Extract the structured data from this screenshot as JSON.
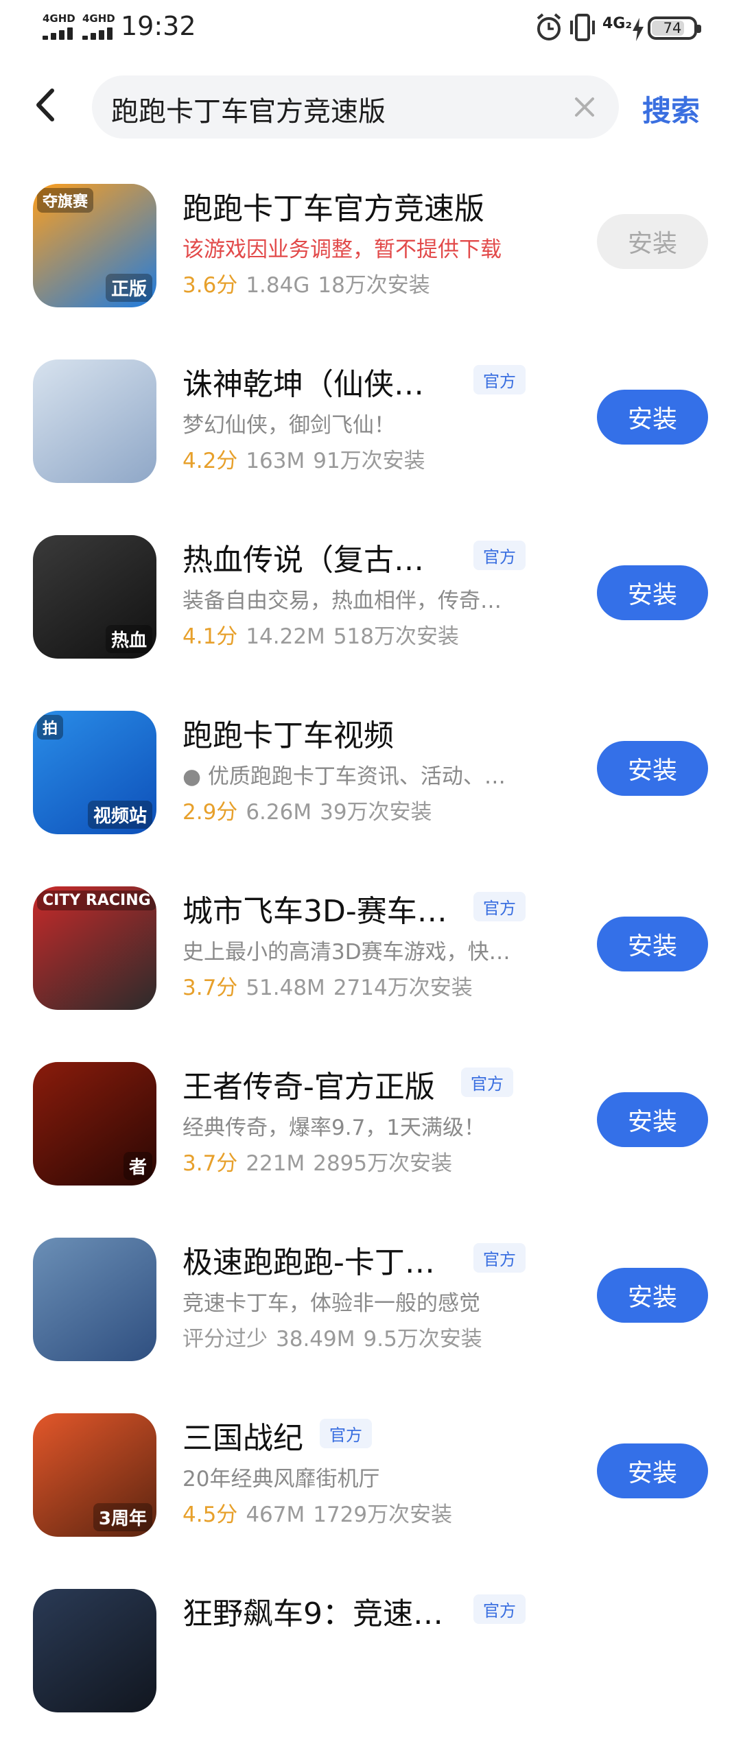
{
  "status_bar": {
    "network_1": "4GHD",
    "network_2": "4GHD",
    "time": "19:32",
    "network_3": "4G₂",
    "battery": "74"
  },
  "search": {
    "query": "跑跑卡丁车官方竞速版",
    "button_label": "搜索"
  },
  "apps": [
    {
      "name": "跑跑卡丁车官方竞速版",
      "official": "",
      "desc": "该游戏因业务调整，暂不提供下载",
      "rating": "3.6分",
      "size": "1.84G",
      "installs": "18万次安装",
      "button": "安装",
      "colors": [
        "#ff9f1c",
        "#1e7be0"
      ],
      "badge_text": "夺旗赛",
      "corner_text": "正版"
    },
    {
      "name": "诛神乾坤（仙侠…",
      "official": "官方",
      "desc": "梦幻仙侠，御剑飞仙！",
      "rating": "4.2分",
      "size": "163M",
      "installs": "91万次安装",
      "button": "安装",
      "colors": [
        "#d7e2ee",
        "#8fa7c7"
      ],
      "badge_text": "",
      "corner_text": ""
    },
    {
      "name": "热血传说（复古…",
      "official": "官方",
      "desc": "装备自由交易，热血相伴，传奇…",
      "rating": "4.1分",
      "size": "14.22M",
      "installs": "518万次安装",
      "button": "安装",
      "colors": [
        "#3a3a3a",
        "#111111"
      ],
      "badge_text": "",
      "corner_text": "热血"
    },
    {
      "name": "跑跑卡丁车视频",
      "official": "",
      "desc": "● 优质跑跑卡丁车资讯、活动、…",
      "rating": "2.9分",
      "size": "6.26M",
      "installs": "39万次安装",
      "button": "安装",
      "colors": [
        "#2a8de8",
        "#0d4fb8"
      ],
      "badge_text": "拍",
      "corner_text": "视频站"
    },
    {
      "name": "城市飞车3D-赛车…",
      "official": "官方",
      "desc": "史上最小的高清3D赛车游戏，快…",
      "rating": "3.7分",
      "size": "51.48M",
      "installs": "2714万次安装",
      "button": "安装",
      "colors": [
        "#c92a2a",
        "#2b2b2b"
      ],
      "badge_text": "CITY RACING",
      "corner_text": ""
    },
    {
      "name": "王者传奇-官方正版",
      "official": "官方",
      "desc": "经典传奇，爆率9.7，1天满级！",
      "rating": "3.7分",
      "size": "221M",
      "installs": "2895万次安装",
      "button": "安装",
      "colors": [
        "#8a1c0c",
        "#2a0703"
      ],
      "badge_text": "",
      "corner_text": "者"
    },
    {
      "name": "极速跑跑跑-卡丁…",
      "official": "官方",
      "desc": "竞速卡丁车，体验非一般的感觉",
      "rating": "评分过少",
      "size": "38.49M",
      "installs": "9.5万次安装",
      "button": "安装",
      "colors": [
        "#6b8fb6",
        "#2f4f80"
      ],
      "badge_text": "",
      "corner_text": ""
    },
    {
      "name": "三国战纪",
      "official": "官方",
      "desc": "20年经典风靡街机厅",
      "rating": "4.5分",
      "size": "467M",
      "installs": "1729万次安装",
      "button": "安装",
      "colors": [
        "#e3572a",
        "#5a2410"
      ],
      "badge_text": "",
      "corner_text": "3周年"
    },
    {
      "name": "狂野飙车9：竞速…",
      "official": "官方",
      "desc": "",
      "rating": "",
      "size": "",
      "installs": "",
      "button": "",
      "colors": [
        "#2a3a55",
        "#11161f"
      ],
      "badge_text": "",
      "corner_text": ""
    }
  ]
}
